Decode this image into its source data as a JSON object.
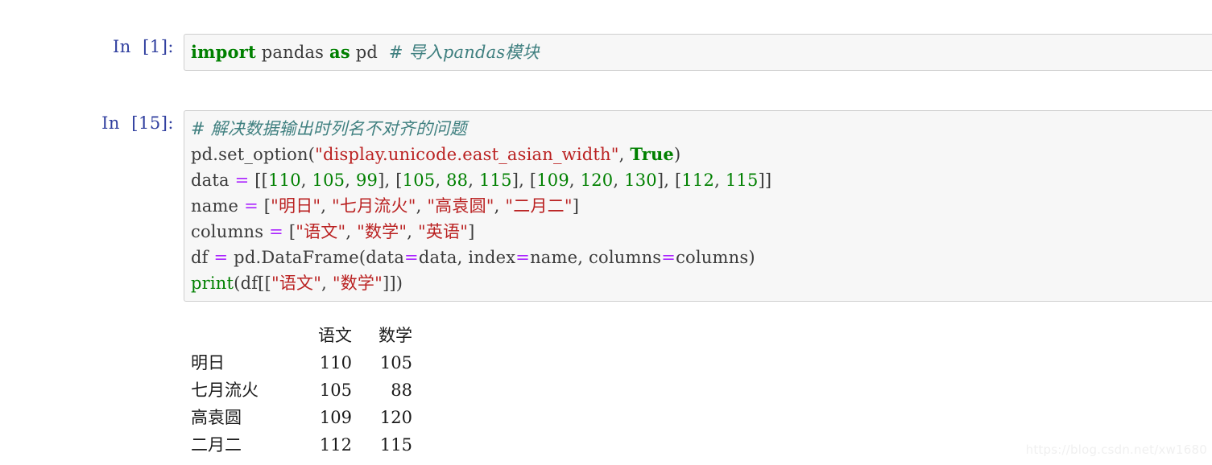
{
  "watermark": "https://blog.csdn.net/xw1680",
  "cells": [
    {
      "prompt": "In  [1]:",
      "lines": [
        {
          "tokens": [
            {
              "t": "import",
              "c": "kw"
            },
            {
              "t": " pandas ",
              "c": "plain"
            },
            {
              "t": "as",
              "c": "kw"
            },
            {
              "t": " pd  ",
              "c": "plain"
            },
            {
              "t": "# 导入pandas模块",
              "c": "comment"
            }
          ]
        }
      ]
    },
    {
      "prompt": "In  [15]:",
      "lines": [
        {
          "tokens": [
            {
              "t": "# 解决数据输出时列名不对齐的问题",
              "c": "comment"
            }
          ]
        },
        {
          "tokens": [
            {
              "t": "pd.set_option(",
              "c": "plain"
            },
            {
              "t": "\"display.unicode.east_asian_width\"",
              "c": "str"
            },
            {
              "t": ", ",
              "c": "plain"
            },
            {
              "t": "True",
              "c": "kw"
            },
            {
              "t": ")",
              "c": "plain"
            }
          ]
        },
        {
          "tokens": [
            {
              "t": "data ",
              "c": "plain"
            },
            {
              "t": "=",
              "c": "op"
            },
            {
              "t": " [[",
              "c": "plain"
            },
            {
              "t": "110",
              "c": "num"
            },
            {
              "t": ", ",
              "c": "plain"
            },
            {
              "t": "105",
              "c": "num"
            },
            {
              "t": ", ",
              "c": "plain"
            },
            {
              "t": "99",
              "c": "num"
            },
            {
              "t": "], [",
              "c": "plain"
            },
            {
              "t": "105",
              "c": "num"
            },
            {
              "t": ", ",
              "c": "plain"
            },
            {
              "t": "88",
              "c": "num"
            },
            {
              "t": ", ",
              "c": "plain"
            },
            {
              "t": "115",
              "c": "num"
            },
            {
              "t": "], [",
              "c": "plain"
            },
            {
              "t": "109",
              "c": "num"
            },
            {
              "t": ", ",
              "c": "plain"
            },
            {
              "t": "120",
              "c": "num"
            },
            {
              "t": ", ",
              "c": "plain"
            },
            {
              "t": "130",
              "c": "num"
            },
            {
              "t": "], [",
              "c": "plain"
            },
            {
              "t": "112",
              "c": "num"
            },
            {
              "t": ", ",
              "c": "plain"
            },
            {
              "t": "115",
              "c": "num"
            },
            {
              "t": "]]",
              "c": "plain"
            }
          ]
        },
        {
          "tokens": [
            {
              "t": "name ",
              "c": "plain"
            },
            {
              "t": "=",
              "c": "op"
            },
            {
              "t": " [",
              "c": "plain"
            },
            {
              "t": "\"明日\"",
              "c": "str"
            },
            {
              "t": ", ",
              "c": "plain"
            },
            {
              "t": "\"七月流火\"",
              "c": "str"
            },
            {
              "t": ", ",
              "c": "plain"
            },
            {
              "t": "\"高袁圆\"",
              "c": "str"
            },
            {
              "t": ", ",
              "c": "plain"
            },
            {
              "t": "\"二月二\"",
              "c": "str"
            },
            {
              "t": "]",
              "c": "plain"
            }
          ]
        },
        {
          "tokens": [
            {
              "t": "columns ",
              "c": "plain"
            },
            {
              "t": "=",
              "c": "op"
            },
            {
              "t": " [",
              "c": "plain"
            },
            {
              "t": "\"语文\"",
              "c": "str"
            },
            {
              "t": ", ",
              "c": "plain"
            },
            {
              "t": "\"数学\"",
              "c": "str"
            },
            {
              "t": ", ",
              "c": "plain"
            },
            {
              "t": "\"英语\"",
              "c": "str"
            },
            {
              "t": "]",
              "c": "plain"
            }
          ]
        },
        {
          "tokens": [
            {
              "t": "df ",
              "c": "plain"
            },
            {
              "t": "=",
              "c": "op"
            },
            {
              "t": " pd.DataFrame(data",
              "c": "plain"
            },
            {
              "t": "=",
              "c": "op"
            },
            {
              "t": "data, index",
              "c": "plain"
            },
            {
              "t": "=",
              "c": "op"
            },
            {
              "t": "name, columns",
              "c": "plain"
            },
            {
              "t": "=",
              "c": "op"
            },
            {
              "t": "columns)",
              "c": "plain"
            }
          ]
        },
        {
          "tokens": [
            {
              "t": "print",
              "c": "builtin"
            },
            {
              "t": "(df[[",
              "c": "plain"
            },
            {
              "t": "\"语文\"",
              "c": "str"
            },
            {
              "t": ", ",
              "c": "plain"
            },
            {
              "t": "\"数学\"",
              "c": "str"
            },
            {
              "t": "]])",
              "c": "plain"
            }
          ]
        }
      ]
    }
  ],
  "output": {
    "columns": [
      "语文",
      "数学"
    ],
    "rows": [
      {
        "index": "明日",
        "values": [
          "110",
          "105"
        ]
      },
      {
        "index": "七月流火",
        "values": [
          "105",
          "88"
        ]
      },
      {
        "index": "高袁圆",
        "values": [
          "109",
          "120"
        ]
      },
      {
        "index": "二月二",
        "values": [
          "112",
          "115"
        ]
      }
    ]
  }
}
